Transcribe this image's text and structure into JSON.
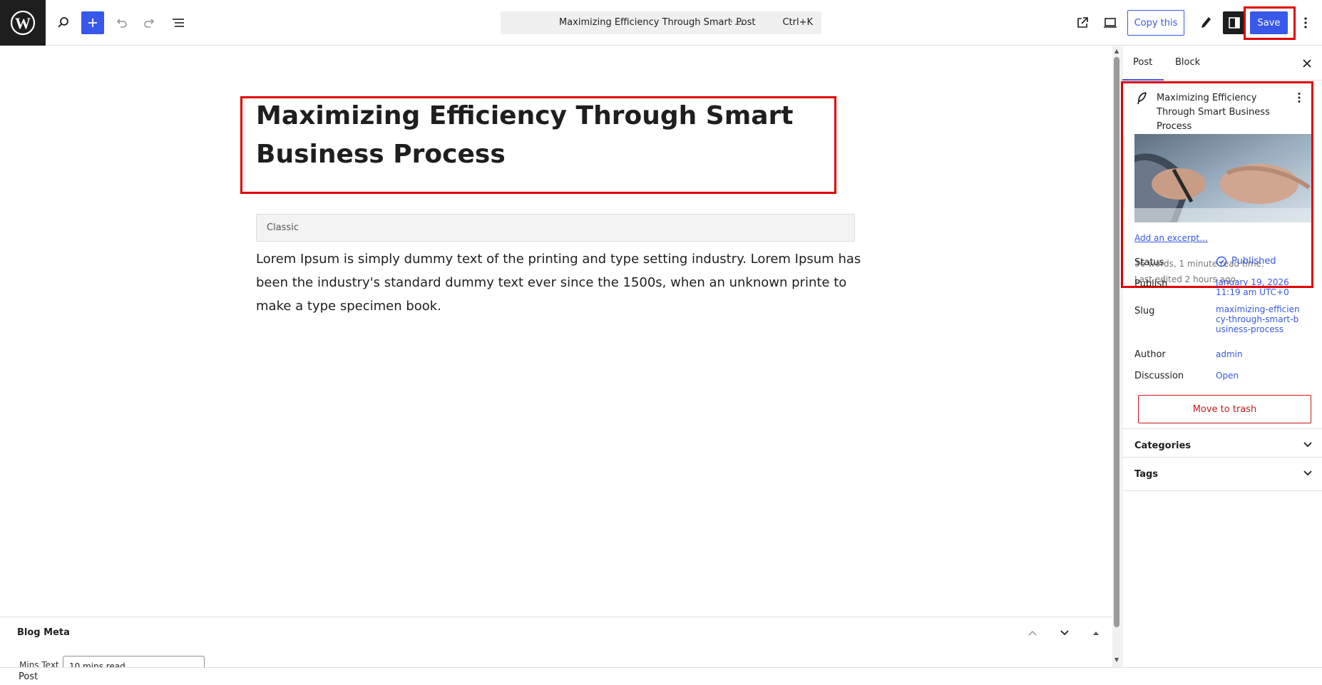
{
  "header": {
    "command_title": "Maximizing Efficiency Through Smart ...",
    "command_type": "· Post",
    "command_shortcut": "Ctrl+K",
    "copy_label": "Copy this",
    "save_label": "Save"
  },
  "editor": {
    "post_title": "Maximizing Efficiency Through Smart Business Process",
    "classic_label": "Classic",
    "paragraph": "Lorem Ipsum is simply dummy text of the printing and type setting industry. Lorem Ipsum has been the industry's standard dummy text ever since the 1500s, when an unknown printe to make a type specimen book."
  },
  "meta_box": {
    "title": "Blog Meta",
    "field_label": "Mins Text",
    "field_value": "10 mins read"
  },
  "footer": {
    "breadcrumb": "Post"
  },
  "sidebar": {
    "tabs": [
      {
        "label": "Post"
      },
      {
        "label": "Block"
      }
    ],
    "summary_title": "Maximizing Efficiency Through Smart Business Process",
    "excerpt_link": "Add an excerpt…",
    "word_count": "36 words, 1 minute read time.",
    "last_edited": "Last edited 2 hours ago.",
    "rows": {
      "status_label": "Status",
      "status_value": "Published",
      "publish_label": "Publish",
      "publish_value": "January 19, 2026 11:19 am UTC+0",
      "slug_label": "Slug",
      "slug_value": "maximizing-efficiency-through-smart-business-process",
      "author_label": "Author",
      "author_value": "admin",
      "discussion_label": "Discussion",
      "discussion_value": "Open"
    },
    "trash_label": "Move to trash",
    "panels": [
      {
        "label": "Categories"
      },
      {
        "label": "Tags"
      }
    ]
  },
  "colors": {
    "accent": "#3858e9",
    "highlight": "#e00000",
    "danger": "#cc1818"
  }
}
